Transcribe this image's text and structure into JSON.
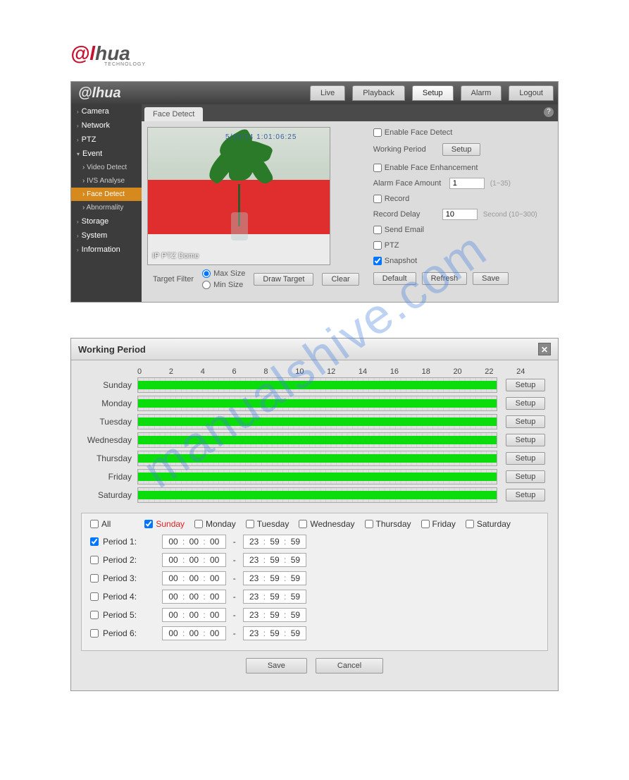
{
  "watermark": "manualshive.com",
  "brand": {
    "name": "alhua",
    "sub": "TECHNOLOGY"
  },
  "nav": [
    "Live",
    "Playback",
    "Setup",
    "Alarm",
    "Logout"
  ],
  "nav_active": 2,
  "sidebar": {
    "groups": [
      {
        "label": "Camera"
      },
      {
        "label": "Network"
      },
      {
        "label": "PTZ"
      },
      {
        "label": "Event",
        "children": [
          {
            "label": "Video Detect"
          },
          {
            "label": "IVS Analyse"
          },
          {
            "label": "Face Detect",
            "active": true
          },
          {
            "label": "Abnormality"
          }
        ]
      },
      {
        "label": "Storage"
      },
      {
        "label": "System"
      },
      {
        "label": "Information"
      }
    ]
  },
  "tab": "Face Detect",
  "preview": {
    "overlay": "IP PTZ Dome",
    "timestamp_overlay": "5/10/14 1:01:06:25"
  },
  "target_filter": {
    "label": "Target Filter",
    "options": [
      "Max Size",
      "Min Size"
    ],
    "selected": 0,
    "draw": "Draw Target",
    "clear": "Clear"
  },
  "controls": {
    "enable_face": {
      "label": "Enable Face Detect",
      "checked": false
    },
    "working_period": {
      "label": "Working Period",
      "btn": "Setup"
    },
    "enable_enhance": {
      "label": "Enable Face Enhancement",
      "checked": false
    },
    "alarm_face": {
      "label": "Alarm Face Amount",
      "value": "1",
      "hint": "(1~35)"
    },
    "record": {
      "label": "Record",
      "checked": false
    },
    "record_delay": {
      "label": "Record Delay",
      "value": "10",
      "hint": "Second (10~300)"
    },
    "send_email": {
      "label": "Send Email",
      "checked": false
    },
    "ptz": {
      "label": "PTZ",
      "checked": false
    },
    "snapshot": {
      "label": "Snapshot",
      "checked": true
    },
    "buttons": [
      "Default",
      "Refresh",
      "Save"
    ]
  },
  "dialog": {
    "title": "Working Period",
    "axis": [
      "0",
      "2",
      "4",
      "6",
      "8",
      "10",
      "12",
      "14",
      "16",
      "18",
      "20",
      "22",
      "24"
    ],
    "days": [
      "Sunday",
      "Monday",
      "Tuesday",
      "Wednesday",
      "Thursday",
      "Friday",
      "Saturday"
    ],
    "setup": "Setup",
    "all": "All",
    "day_checks": [
      {
        "label": "Sunday",
        "checked": true
      },
      {
        "label": "Monday",
        "checked": false
      },
      {
        "label": "Tuesday",
        "checked": false
      },
      {
        "label": "Wednesday",
        "checked": false
      },
      {
        "label": "Thursday",
        "checked": false
      },
      {
        "label": "Friday",
        "checked": false
      },
      {
        "label": "Saturday",
        "checked": false
      }
    ],
    "periods": [
      {
        "label": "Period 1:",
        "checked": true,
        "from": [
          "00",
          "00",
          "00"
        ],
        "to": [
          "23",
          "59",
          "59"
        ]
      },
      {
        "label": "Period 2:",
        "checked": false,
        "from": [
          "00",
          "00",
          "00"
        ],
        "to": [
          "23",
          "59",
          "59"
        ]
      },
      {
        "label": "Period 3:",
        "checked": false,
        "from": [
          "00",
          "00",
          "00"
        ],
        "to": [
          "23",
          "59",
          "59"
        ]
      },
      {
        "label": "Period 4:",
        "checked": false,
        "from": [
          "00",
          "00",
          "00"
        ],
        "to": [
          "23",
          "59",
          "59"
        ]
      },
      {
        "label": "Period 5:",
        "checked": false,
        "from": [
          "00",
          "00",
          "00"
        ],
        "to": [
          "23",
          "59",
          "59"
        ]
      },
      {
        "label": "Period 6:",
        "checked": false,
        "from": [
          "00",
          "00",
          "00"
        ],
        "to": [
          "23",
          "59",
          "59"
        ]
      }
    ],
    "save": "Save",
    "cancel": "Cancel"
  }
}
